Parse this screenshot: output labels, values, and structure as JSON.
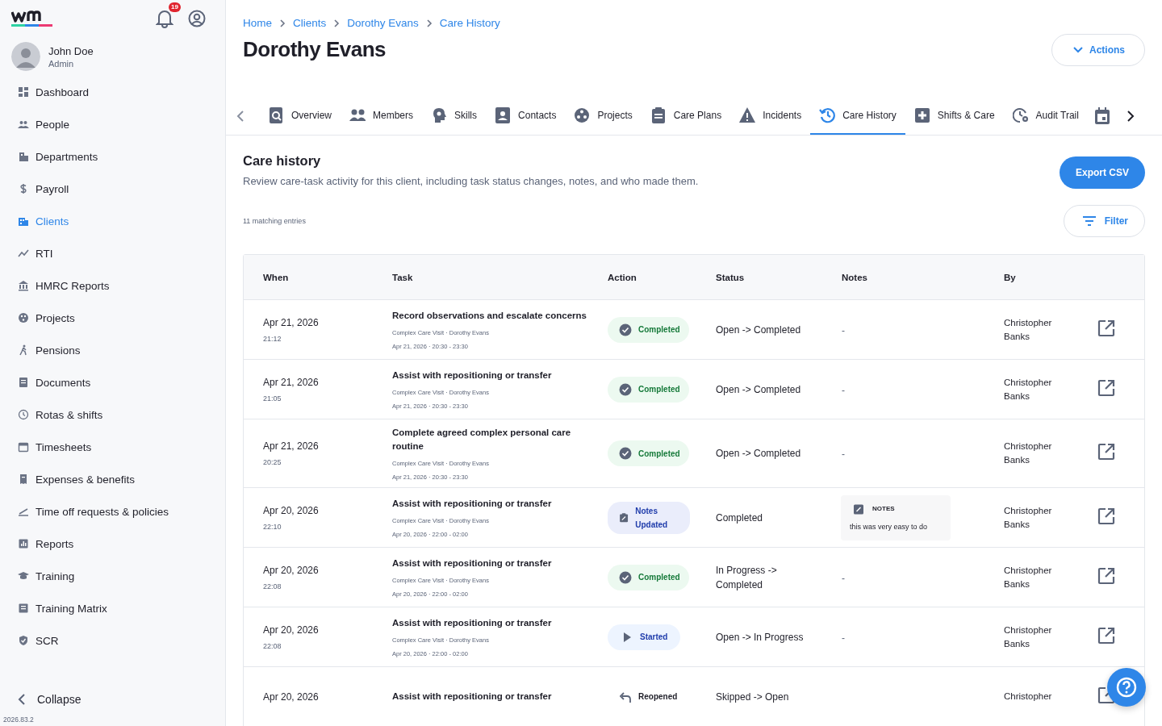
{
  "sidebar": {
    "notifications": "19",
    "user": {
      "name": "John Doe",
      "role": "Admin"
    },
    "items": [
      {
        "label": "Dashboard",
        "selected": false
      },
      {
        "label": "People",
        "selected": false
      },
      {
        "label": "Departments",
        "selected": false
      },
      {
        "label": "Payroll",
        "selected": false
      },
      {
        "label": "Clients",
        "selected": true
      },
      {
        "label": "RTI",
        "selected": false
      },
      {
        "label": "HMRC Reports",
        "selected": false
      },
      {
        "label": "Projects",
        "selected": false
      },
      {
        "label": "Pensions",
        "selected": false
      },
      {
        "label": "Documents",
        "selected": false
      },
      {
        "label": "Rotas & shifts",
        "selected": false
      },
      {
        "label": "Timesheets",
        "selected": false
      },
      {
        "label": "Expenses & benefits",
        "selected": false
      },
      {
        "label": "Time off requests & policies",
        "selected": false
      },
      {
        "label": "Reports",
        "selected": false
      },
      {
        "label": "Training",
        "selected": false
      },
      {
        "label": "Training Matrix",
        "selected": false
      },
      {
        "label": "SCR",
        "selected": false
      }
    ],
    "collapse": "Collapse",
    "version": "2026.83.2"
  },
  "breadcrumb": [
    "Home",
    "Clients",
    "Dorothy Evans",
    "Care History"
  ],
  "title": "Dorothy Evans",
  "actions_button": "Actions",
  "tabs": [
    {
      "label": "Overview",
      "selected": false
    },
    {
      "label": "Members",
      "selected": false
    },
    {
      "label": "Skills",
      "selected": false
    },
    {
      "label": "Contacts",
      "selected": false
    },
    {
      "label": "Projects",
      "selected": false
    },
    {
      "label": "Care Plans",
      "selected": false
    },
    {
      "label": "Incidents",
      "selected": false
    },
    {
      "label": "Care History",
      "selected": true
    },
    {
      "label": "Shifts & Care",
      "selected": false
    },
    {
      "label": "Audit Trail",
      "selected": false
    }
  ],
  "section": {
    "heading": "Care history",
    "description": "Review care-task activity for this client, including task status changes, notes, and who made them.",
    "export_button": "Export CSV",
    "count": "11 matching entries",
    "filter_button": "Filter"
  },
  "table": {
    "columns": [
      "When",
      "Task",
      "Action",
      "Status",
      "Notes",
      "By"
    ],
    "rows": [
      {
        "date": "Apr 21, 2026",
        "time": "21:12",
        "task": "Record observations and escalate concerns",
        "visit": "Complex Care Visit · Dorothy Evans",
        "slot": "Apr 21, 2026 · 20:30 - 23:30",
        "action": {
          "kind": "completed",
          "label": "Completed"
        },
        "status": "Open -> Completed",
        "notes": "-",
        "by": "Christopher Banks"
      },
      {
        "date": "Apr 21, 2026",
        "time": "21:05",
        "task": "Assist with repositioning or transfer",
        "visit": "Complex Care Visit · Dorothy Evans",
        "slot": "Apr 21, 2026 · 20:30 - 23:30",
        "action": {
          "kind": "completed",
          "label": "Completed"
        },
        "status": "Open -> Completed",
        "notes": "-",
        "by": "Christopher Banks"
      },
      {
        "date": "Apr 21, 2026",
        "time": "20:25",
        "task": "Complete agreed complex personal care routine",
        "visit": "Complex Care Visit · Dorothy Evans",
        "slot": "Apr 21, 2026 · 20:30 - 23:30",
        "action": {
          "kind": "completed",
          "label": "Completed"
        },
        "status": "Open -> Completed",
        "notes": "-",
        "by": "Christopher Banks"
      },
      {
        "date": "Apr 20, 2026",
        "time": "22:10",
        "task": "Assist with repositioning or transfer",
        "visit": "Complex Care Visit · Dorothy Evans",
        "slot": "Apr 20, 2026 · 22:00 - 02:00",
        "action": {
          "kind": "notes",
          "label": "Notes Updated"
        },
        "status": "Completed",
        "notes_card": {
          "title": "NOTES",
          "text": "this was very easy to do"
        },
        "by": "Christopher Banks"
      },
      {
        "date": "Apr 20, 2026",
        "time": "22:08",
        "task": "Assist with repositioning or transfer",
        "visit": "Complex Care Visit · Dorothy Evans",
        "slot": "Apr 20, 2026 · 22:00 - 02:00",
        "action": {
          "kind": "completed",
          "label": "Completed"
        },
        "status": "In Progress -> Completed",
        "notes": "-",
        "by": "Christopher Banks"
      },
      {
        "date": "Apr 20, 2026",
        "time": "22:08",
        "task": "Assist with repositioning or transfer",
        "visit": "Complex Care Visit · Dorothy Evans",
        "slot": "Apr 20, 2026 · 22:00 - 02:00",
        "action": {
          "kind": "started",
          "label": "Started"
        },
        "status": "Open -> In Progress",
        "notes": "-",
        "by": "Christopher Banks"
      },
      {
        "date": "Apr 20, 2026",
        "task": "Assist with repositioning or transfer",
        "action": {
          "kind": "reopened",
          "label": "Reopened"
        },
        "status": "Skipped -> Open",
        "by": "Christopher"
      }
    ]
  }
}
